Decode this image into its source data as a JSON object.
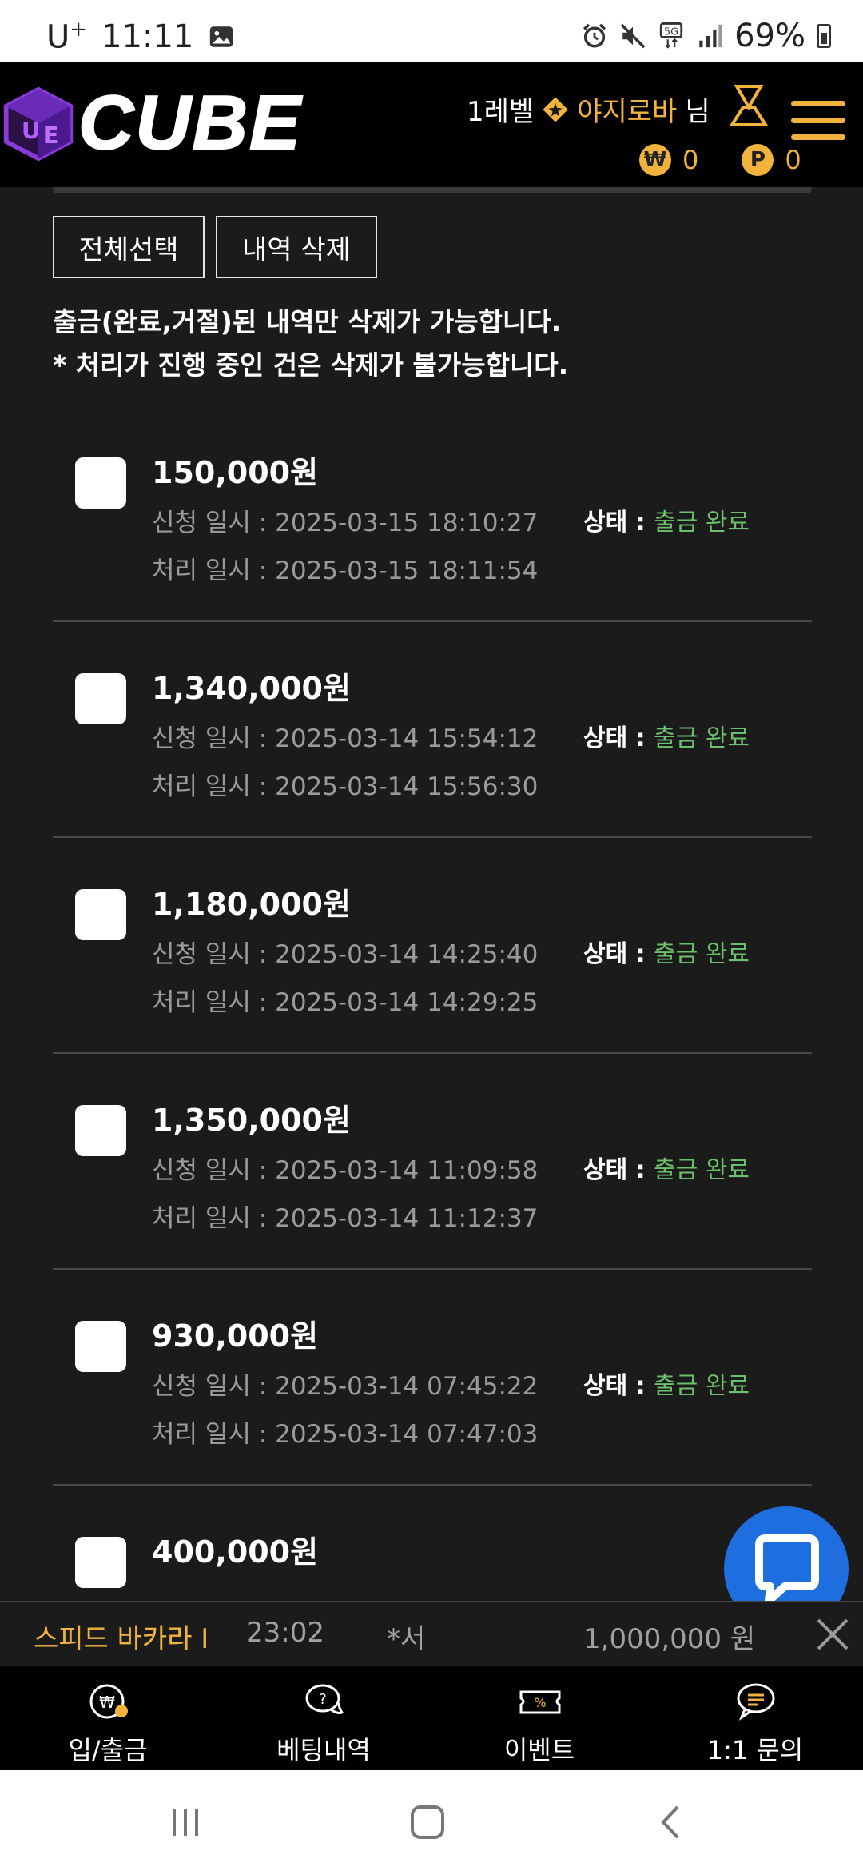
{
  "status_bar": {
    "carrier": "U",
    "carrier_sup": "+",
    "time": "11:11",
    "battery": "69%"
  },
  "header": {
    "logo_text": "CUBE",
    "level": "1레벨",
    "username": "야지로바",
    "honorific": "님",
    "money_icon": "₩",
    "money": "0",
    "point_icon": "P",
    "points": "0"
  },
  "actions": {
    "select_all": "전체선택",
    "delete": "내역 삭제"
  },
  "notice": {
    "line1": "출금(완료,거절)된 내역만 삭제가 가능합니다.",
    "line2": "* 처리가 진행 중인 건은 삭제가 불가능합니다."
  },
  "labels": {
    "request": "신청 일시 : ",
    "processed": "처리 일시 : ",
    "status": "상태 : "
  },
  "withdrawals": [
    {
      "amount": "150,000원",
      "request_date": "2025-03-15 18:10:27",
      "process_date": "2025-03-15 18:11:54",
      "status": "출금 완료"
    },
    {
      "amount": "1,340,000원",
      "request_date": "2025-03-14 15:54:12",
      "process_date": "2025-03-14 15:56:30",
      "status": "출금 완료"
    },
    {
      "amount": "1,180,000원",
      "request_date": "2025-03-14 14:25:40",
      "process_date": "2025-03-14 14:29:25",
      "status": "출금 완료"
    },
    {
      "amount": "1,350,000원",
      "request_date": "2025-03-14 11:09:58",
      "process_date": "2025-03-14 11:12:37",
      "status": "출금 완료"
    },
    {
      "amount": "930,000원",
      "request_date": "2025-03-14 07:45:22",
      "process_date": "2025-03-14 07:47:03",
      "status": "출금 완료"
    },
    {
      "amount": "400,000원"
    }
  ],
  "ticker": {
    "game": "스피드 바카라 I",
    "time": "23:02",
    "user": "*서",
    "amount": "1,000,000 원"
  },
  "bottom_nav": [
    {
      "label": "입/출금",
      "icon": "deposit-withdraw-icon"
    },
    {
      "label": "베팅내역",
      "icon": "betting-history-icon"
    },
    {
      "label": "이벤트",
      "icon": "event-ticket-icon"
    },
    {
      "label": "1:1 문의",
      "icon": "inquiry-chat-icon"
    }
  ],
  "colors": {
    "accent": "#f2b33d",
    "status_ok": "#6cc06c",
    "chat_fab": "#1f6ee0",
    "background": "#1b1b1b"
  }
}
